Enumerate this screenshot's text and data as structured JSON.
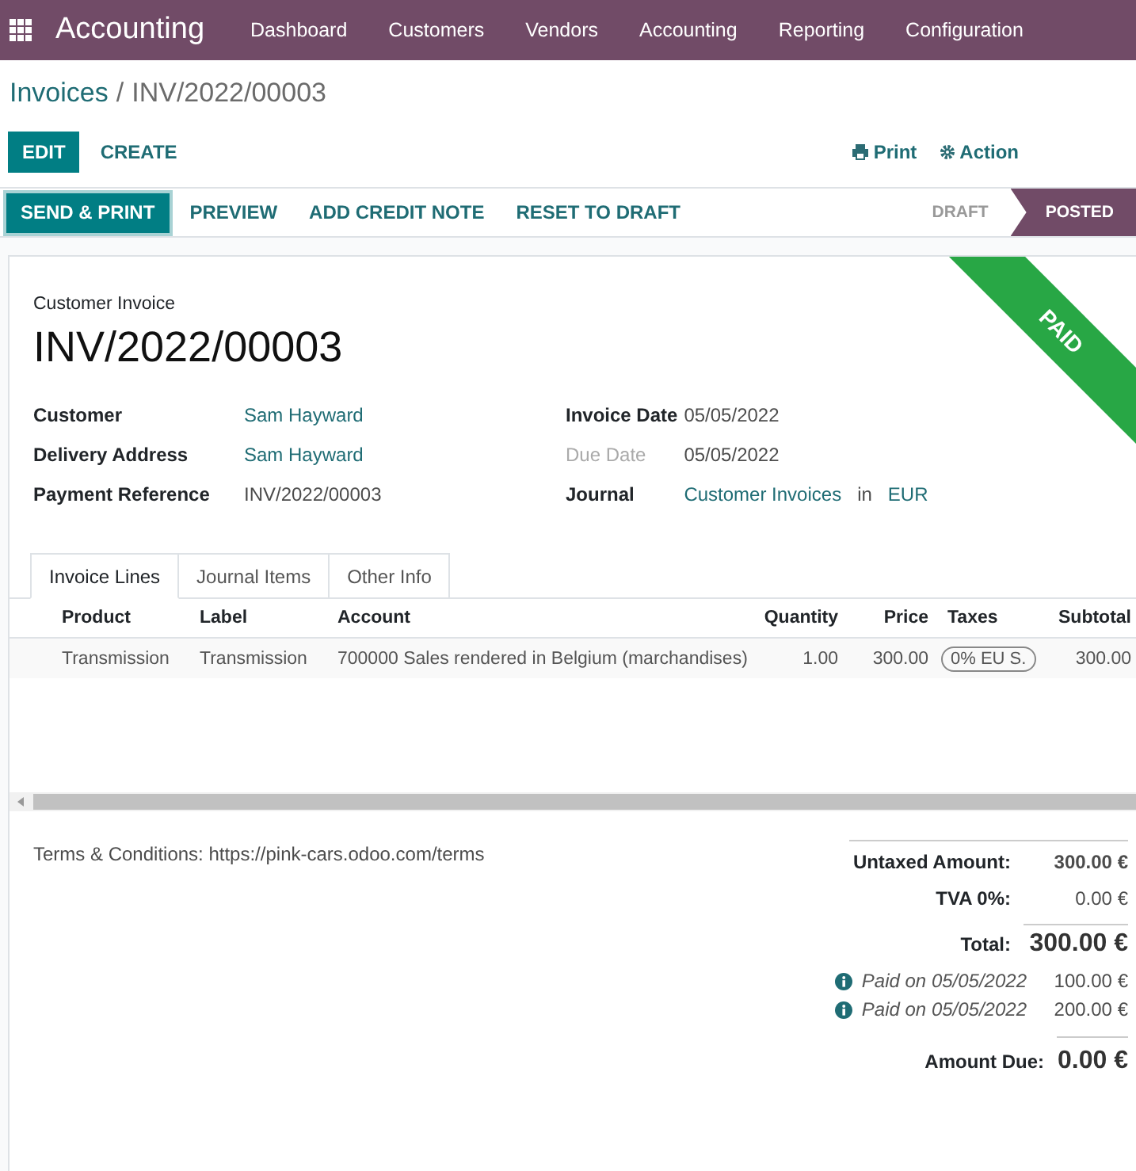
{
  "app": {
    "name": "Accounting"
  },
  "menu": [
    "Dashboard",
    "Customers",
    "Vendors",
    "Accounting",
    "Reporting",
    "Configuration"
  ],
  "breadcrumb": {
    "parent": "Invoices",
    "separator": "/",
    "current": "INV/2022/00003"
  },
  "control_buttons": [
    {
      "label": "EDIT",
      "kind": "primary"
    },
    {
      "label": "CREATE",
      "kind": "link"
    }
  ],
  "side_actions": [
    {
      "label": "Print",
      "kind": "print"
    },
    {
      "label": "Action",
      "kind": "gear"
    }
  ],
  "header_buttons": [
    {
      "label": "SEND & PRINT",
      "kind": "primary"
    },
    {
      "label": "PREVIEW",
      "kind": "link"
    },
    {
      "label": "ADD CREDIT NOTE",
      "kind": "link"
    },
    {
      "label": "RESET TO DRAFT",
      "kind": "link"
    }
  ],
  "statuses": [
    {
      "label": "DRAFT",
      "selected": false
    },
    {
      "label": "POSTED",
      "selected": true
    }
  ],
  "ribbon": "PAID",
  "form": {
    "type": "Customer Invoice",
    "number": "INV/2022/00003",
    "left_fields": [
      {
        "label": "Customer",
        "muted": false,
        "parts": [
          {
            "text": "Sam Hayward",
            "kind": "link"
          }
        ]
      },
      {
        "label": "Delivery Address",
        "muted": false,
        "parts": [
          {
            "text": "Sam Hayward",
            "kind": "link"
          }
        ]
      },
      {
        "label": "Payment Reference",
        "muted": false,
        "parts": [
          {
            "text": "INV/2022/00003",
            "kind": "plain"
          }
        ]
      }
    ],
    "right_fields": [
      {
        "label": "Invoice Date",
        "muted": false,
        "parts": [
          {
            "text": "05/05/2022",
            "kind": "plain"
          }
        ]
      },
      {
        "label": "Due Date",
        "muted": true,
        "parts": [
          {
            "text": "05/05/2022",
            "kind": "plain"
          }
        ]
      },
      {
        "label": "Journal",
        "muted": false,
        "parts": [
          {
            "text": "Customer Invoices",
            "kind": "link"
          },
          {
            "text": "in",
            "kind": "plain"
          },
          {
            "text": "EUR",
            "kind": "link"
          }
        ]
      }
    ]
  },
  "tabs": [
    {
      "label": "Invoice Lines",
      "selected": true
    },
    {
      "label": "Journal Items",
      "selected": false
    },
    {
      "label": "Other Info",
      "selected": false
    }
  ],
  "table": {
    "columns": [
      {
        "label": "Product",
        "kind": "text"
      },
      {
        "label": "Label",
        "kind": "text"
      },
      {
        "label": "Account",
        "kind": "text"
      },
      {
        "label": "Quantity",
        "kind": "number"
      },
      {
        "label": "Price",
        "kind": "number"
      },
      {
        "label": "Taxes",
        "kind": "tags"
      },
      {
        "label": "Subtotal",
        "kind": "number"
      }
    ],
    "rows": [
      {
        "cells": [
          "Transmission",
          "Transmission",
          "700000 Sales rendered in Belgium (marchandises)",
          "1.00",
          "300.00",
          [
            "0% EU S."
          ],
          "300.00"
        ]
      }
    ]
  },
  "terms": "Terms & Conditions: https://pink-cars.odoo.com/terms",
  "totals": [
    {
      "label": "Untaxed Amount:",
      "value": "300.00 €",
      "kind": "subtotal"
    },
    {
      "label": "TVA 0%:",
      "value": "0.00 €",
      "kind": "tax"
    },
    {
      "label": "Total:",
      "value": "300.00 €",
      "kind": "total"
    }
  ],
  "payments": [
    {
      "text": "Paid on 05/05/2022",
      "amount": "100.00 €"
    },
    {
      "text": "Paid on 05/05/2022",
      "amount": "200.00 €"
    }
  ],
  "amount_due": {
    "label": "Amount Due:",
    "value": "0.00 €"
  }
}
